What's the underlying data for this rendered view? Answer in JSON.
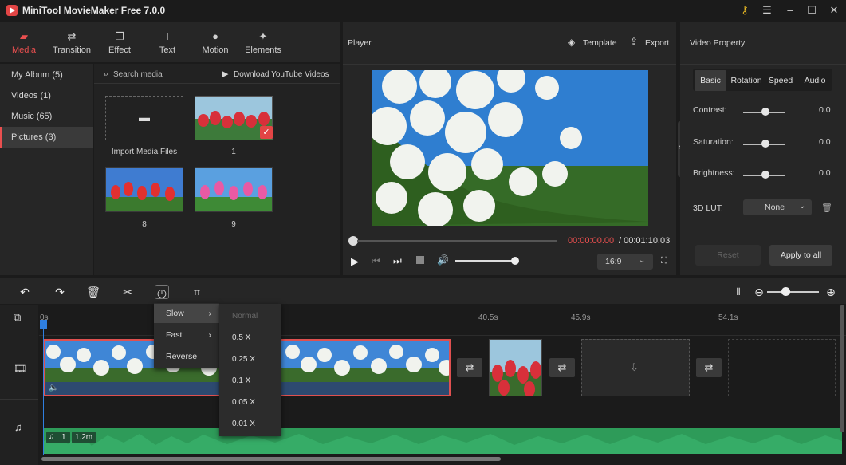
{
  "app": {
    "title": "MiniTool MovieMaker Free 7.0.0"
  },
  "toolbar_tabs": [
    {
      "label": "Media",
      "icon": "folder-icon",
      "active": true
    },
    {
      "label": "Transition",
      "icon": "transition-icon"
    },
    {
      "label": "Effect",
      "icon": "effect-icon"
    },
    {
      "label": "Text",
      "icon": "text-icon"
    },
    {
      "label": "Motion",
      "icon": "motion-icon"
    },
    {
      "label": "Elements",
      "icon": "elements-icon"
    }
  ],
  "library": {
    "items": [
      {
        "label": "My Album (5)"
      },
      {
        "label": "Videos (1)"
      },
      {
        "label": "Music (65)"
      },
      {
        "label": "Pictures (3)",
        "active": true
      }
    ],
    "search_placeholder": "Search media",
    "download_label": "Download YouTube Videos",
    "import_label": "Import Media Files",
    "thumbs": [
      {
        "label": "1",
        "checked": true
      },
      {
        "label": "8"
      },
      {
        "label": "9"
      }
    ]
  },
  "player": {
    "title": "Player",
    "template_label": "Template",
    "export_label": "Export",
    "current_time": "00:00:00.00",
    "total_time": "/ 00:01:10.03",
    "aspect": "16:9"
  },
  "property": {
    "title": "Video Property",
    "tabs": [
      "Basic",
      "Rotation",
      "Speed",
      "Audio"
    ],
    "active_tab": "Basic",
    "rows": [
      {
        "label": "Contrast:",
        "value": "0.0"
      },
      {
        "label": "Saturation:",
        "value": "0.0"
      },
      {
        "label": "Brightness:",
        "value": "0.0"
      }
    ],
    "lut_label": "3D LUT:",
    "lut_value": "None",
    "reset_label": "Reset",
    "apply_label": "Apply to all"
  },
  "timeline": {
    "ruler": [
      "0s",
      "40.5s",
      "45.9s",
      "54.1s"
    ],
    "audio_badge_count": "1",
    "audio_badge_len": "1.2m"
  },
  "speed_menu": {
    "items": [
      "Slow",
      "Fast",
      "Reverse"
    ],
    "active": "Slow",
    "sub_items": [
      "Normal",
      "0.5 X",
      "0.25 X",
      "0.1 X",
      "0.05 X",
      "0.01 X"
    ]
  },
  "colors": {
    "accent": "#ea4f4f",
    "audio": "#2e9b59",
    "clip_border": "#e05050"
  }
}
